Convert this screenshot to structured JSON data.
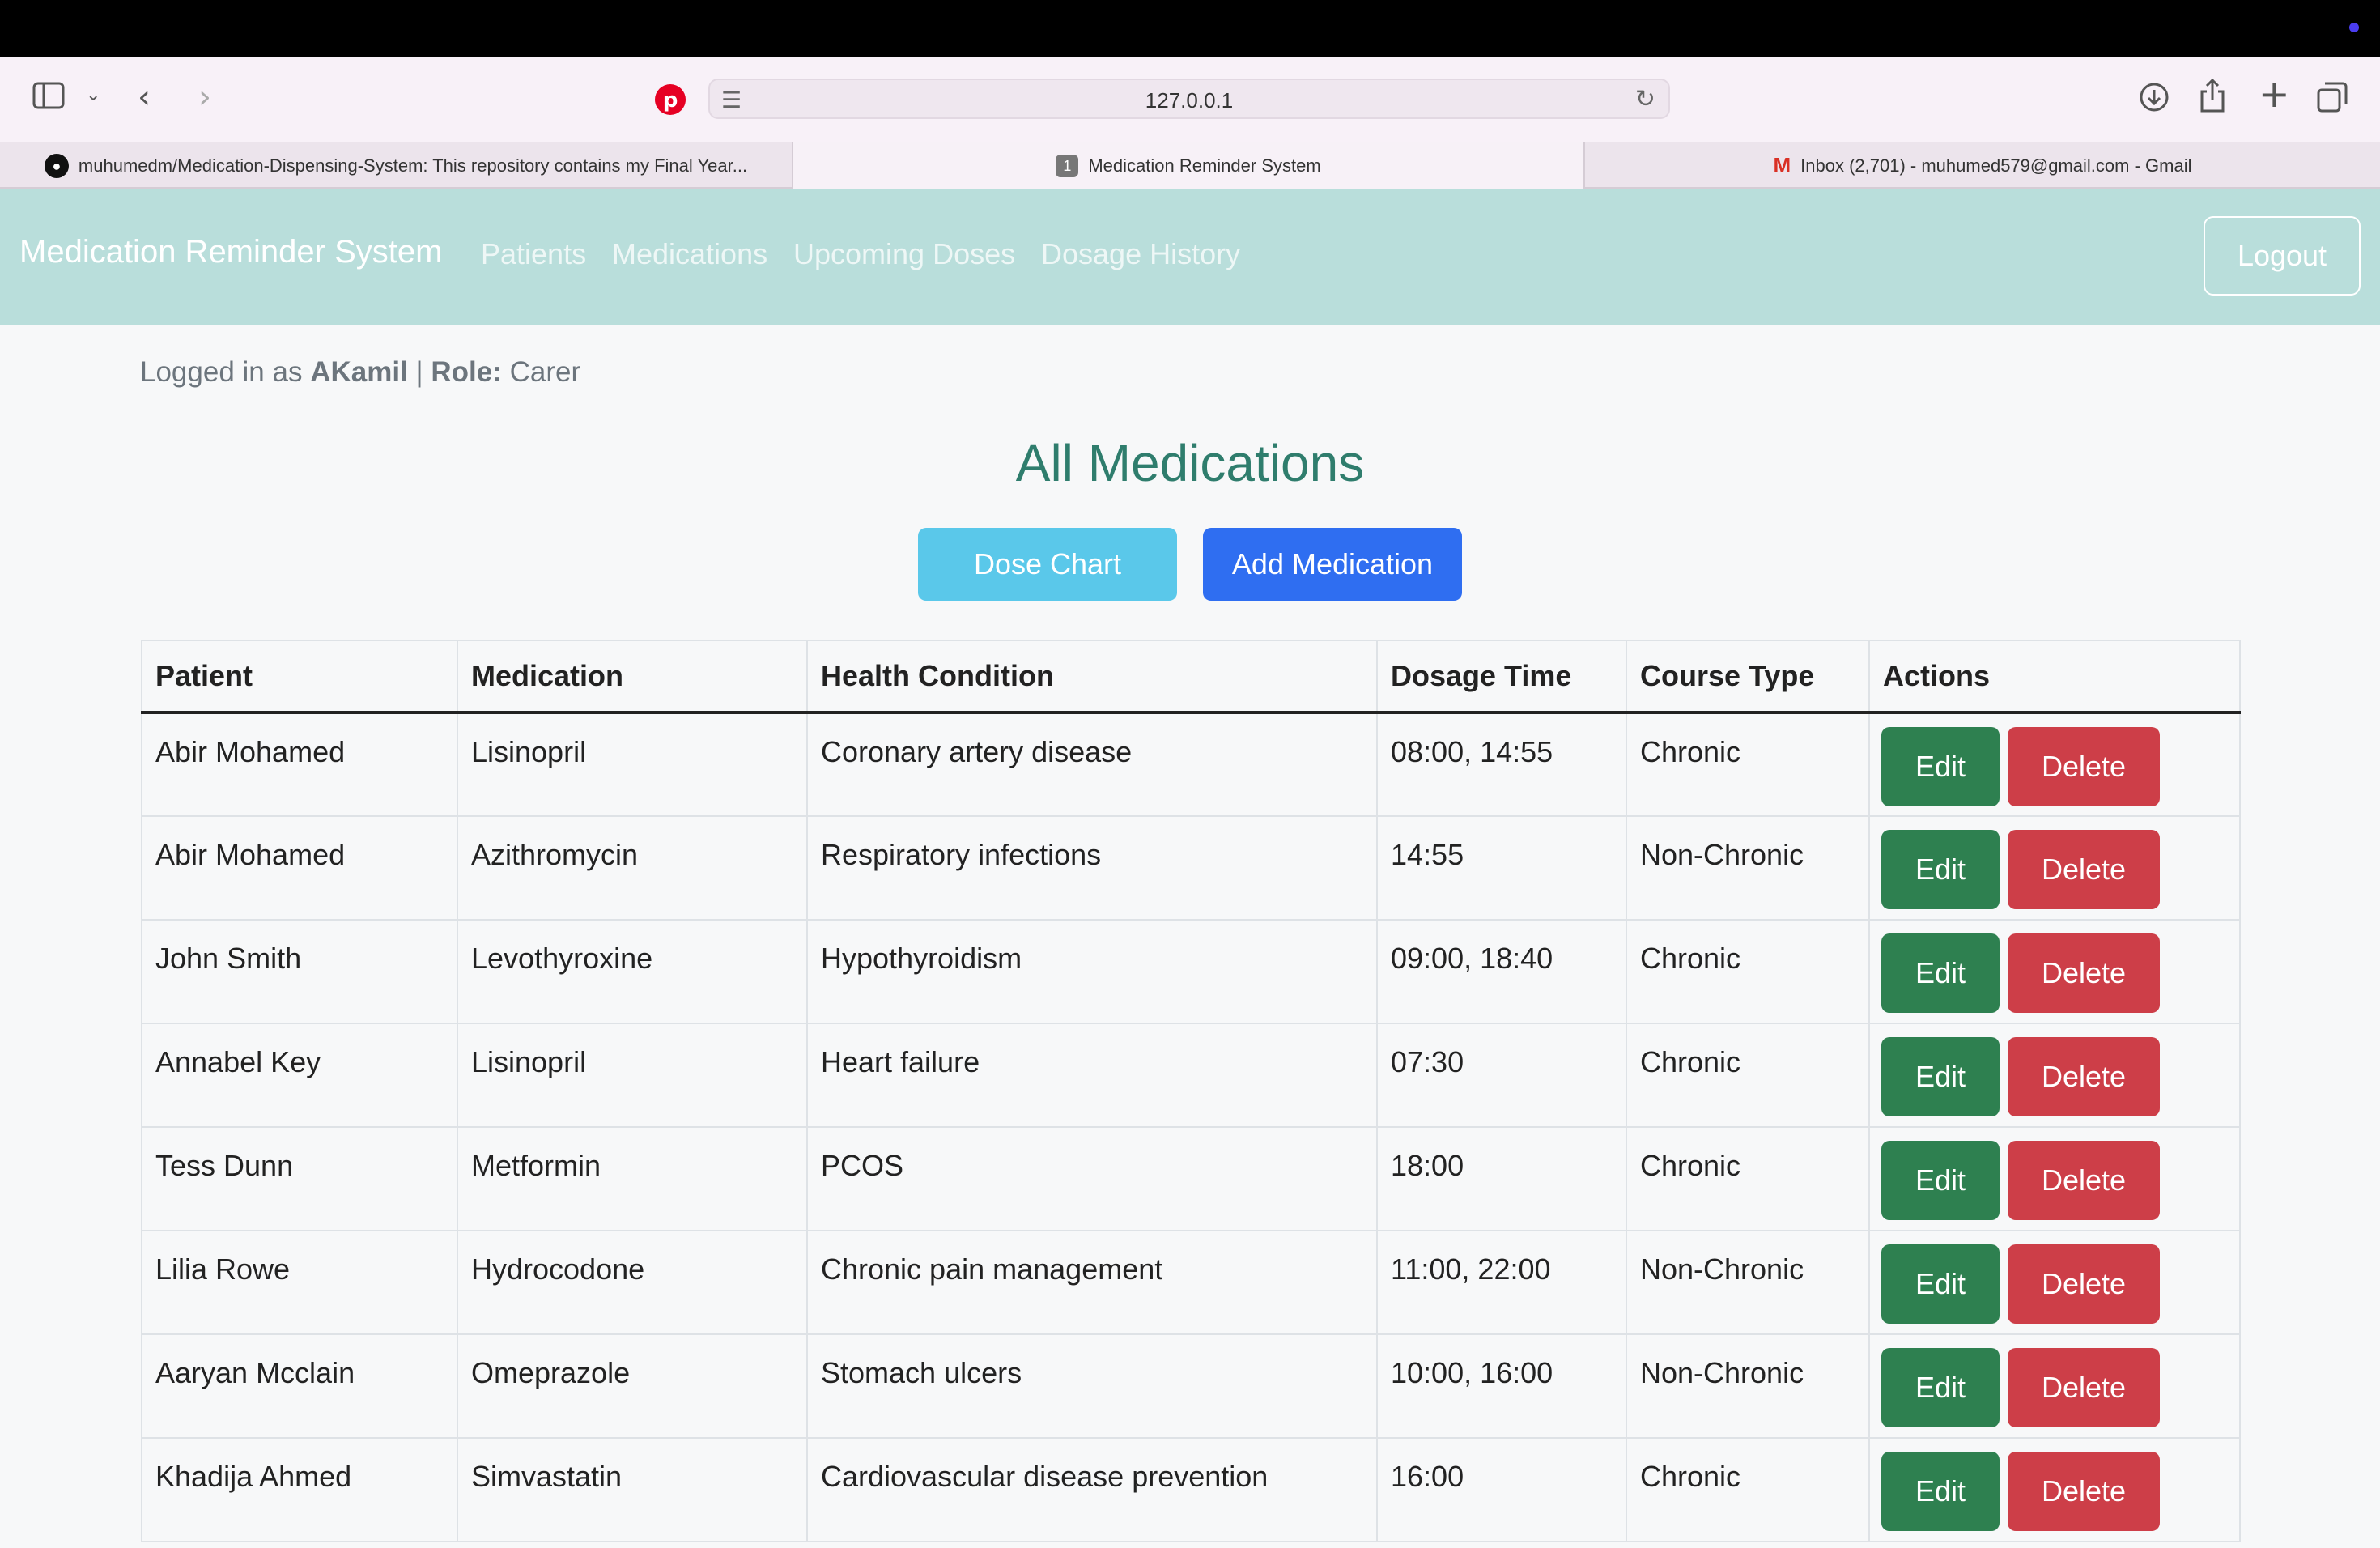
{
  "browser": {
    "url": "127.0.0.1",
    "tabs": [
      {
        "label": "muhumedm/Medication-Dispensing-System: This repository contains my Final Year...",
        "icon": "github-icon"
      },
      {
        "label": "Medication Reminder System",
        "badge": "1",
        "icon": "tab-number-icon"
      },
      {
        "label": "Inbox (2,701) - muhumed579@gmail.com - Gmail",
        "icon": "gmail-icon"
      }
    ]
  },
  "nav": {
    "brand": "Medication Reminder System",
    "links": [
      "Patients",
      "Medications",
      "Upcoming Doses",
      "Dosage History"
    ],
    "logout": "Logout"
  },
  "user": {
    "prefix": "Logged in as",
    "username": "AKamil",
    "separator": "|",
    "role_label": "Role:",
    "role": "Carer"
  },
  "page": {
    "title": "All Medications",
    "dose_chart_button": "Dose Chart",
    "add_medication_button": "Add Medication"
  },
  "table": {
    "headers": [
      "Patient",
      "Medication",
      "Health Condition",
      "Dosage Time",
      "Course Type",
      "Actions"
    ],
    "edit_label": "Edit",
    "delete_label": "Delete",
    "rows": [
      {
        "patient": "Abir Mohamed",
        "medication": "Lisinopril",
        "condition": "Coronary artery disease",
        "time": "08:00, 14:55",
        "course": "Chronic"
      },
      {
        "patient": "Abir Mohamed",
        "medication": "Azithromycin",
        "condition": "Respiratory infections",
        "time": "14:55",
        "course": "Non-Chronic"
      },
      {
        "patient": "John Smith",
        "medication": "Levothyroxine",
        "condition": "Hypothyroidism",
        "time": "09:00, 18:40",
        "course": "Chronic"
      },
      {
        "patient": "Annabel Key",
        "medication": "Lisinopril",
        "condition": "Heart failure",
        "time": "07:30",
        "course": "Chronic"
      },
      {
        "patient": "Tess Dunn",
        "medication": "Metformin",
        "condition": "PCOS",
        "time": "18:00",
        "course": "Chronic"
      },
      {
        "patient": "Lilia Rowe",
        "medication": "Hydrocodone",
        "condition": "Chronic pain management",
        "time": "11:00, 22:00",
        "course": "Non-Chronic"
      },
      {
        "patient": "Aaryan Mcclain",
        "medication": "Omeprazole",
        "condition": "Stomach ulcers",
        "time": "10:00, 16:00",
        "course": "Non-Chronic"
      },
      {
        "patient": "Khadija Ahmed",
        "medication": "Simvastatin",
        "condition": "Cardiovascular disease prevention",
        "time": "16:00",
        "course": "Chronic"
      }
    ]
  },
  "colors": {
    "navbar": "#b9dedb",
    "title": "#2f7d6d",
    "dose_chart": "#5ac8ea",
    "add_medication": "#2f6ef1",
    "edit": "#2e8050",
    "delete": "#cd3e48"
  }
}
